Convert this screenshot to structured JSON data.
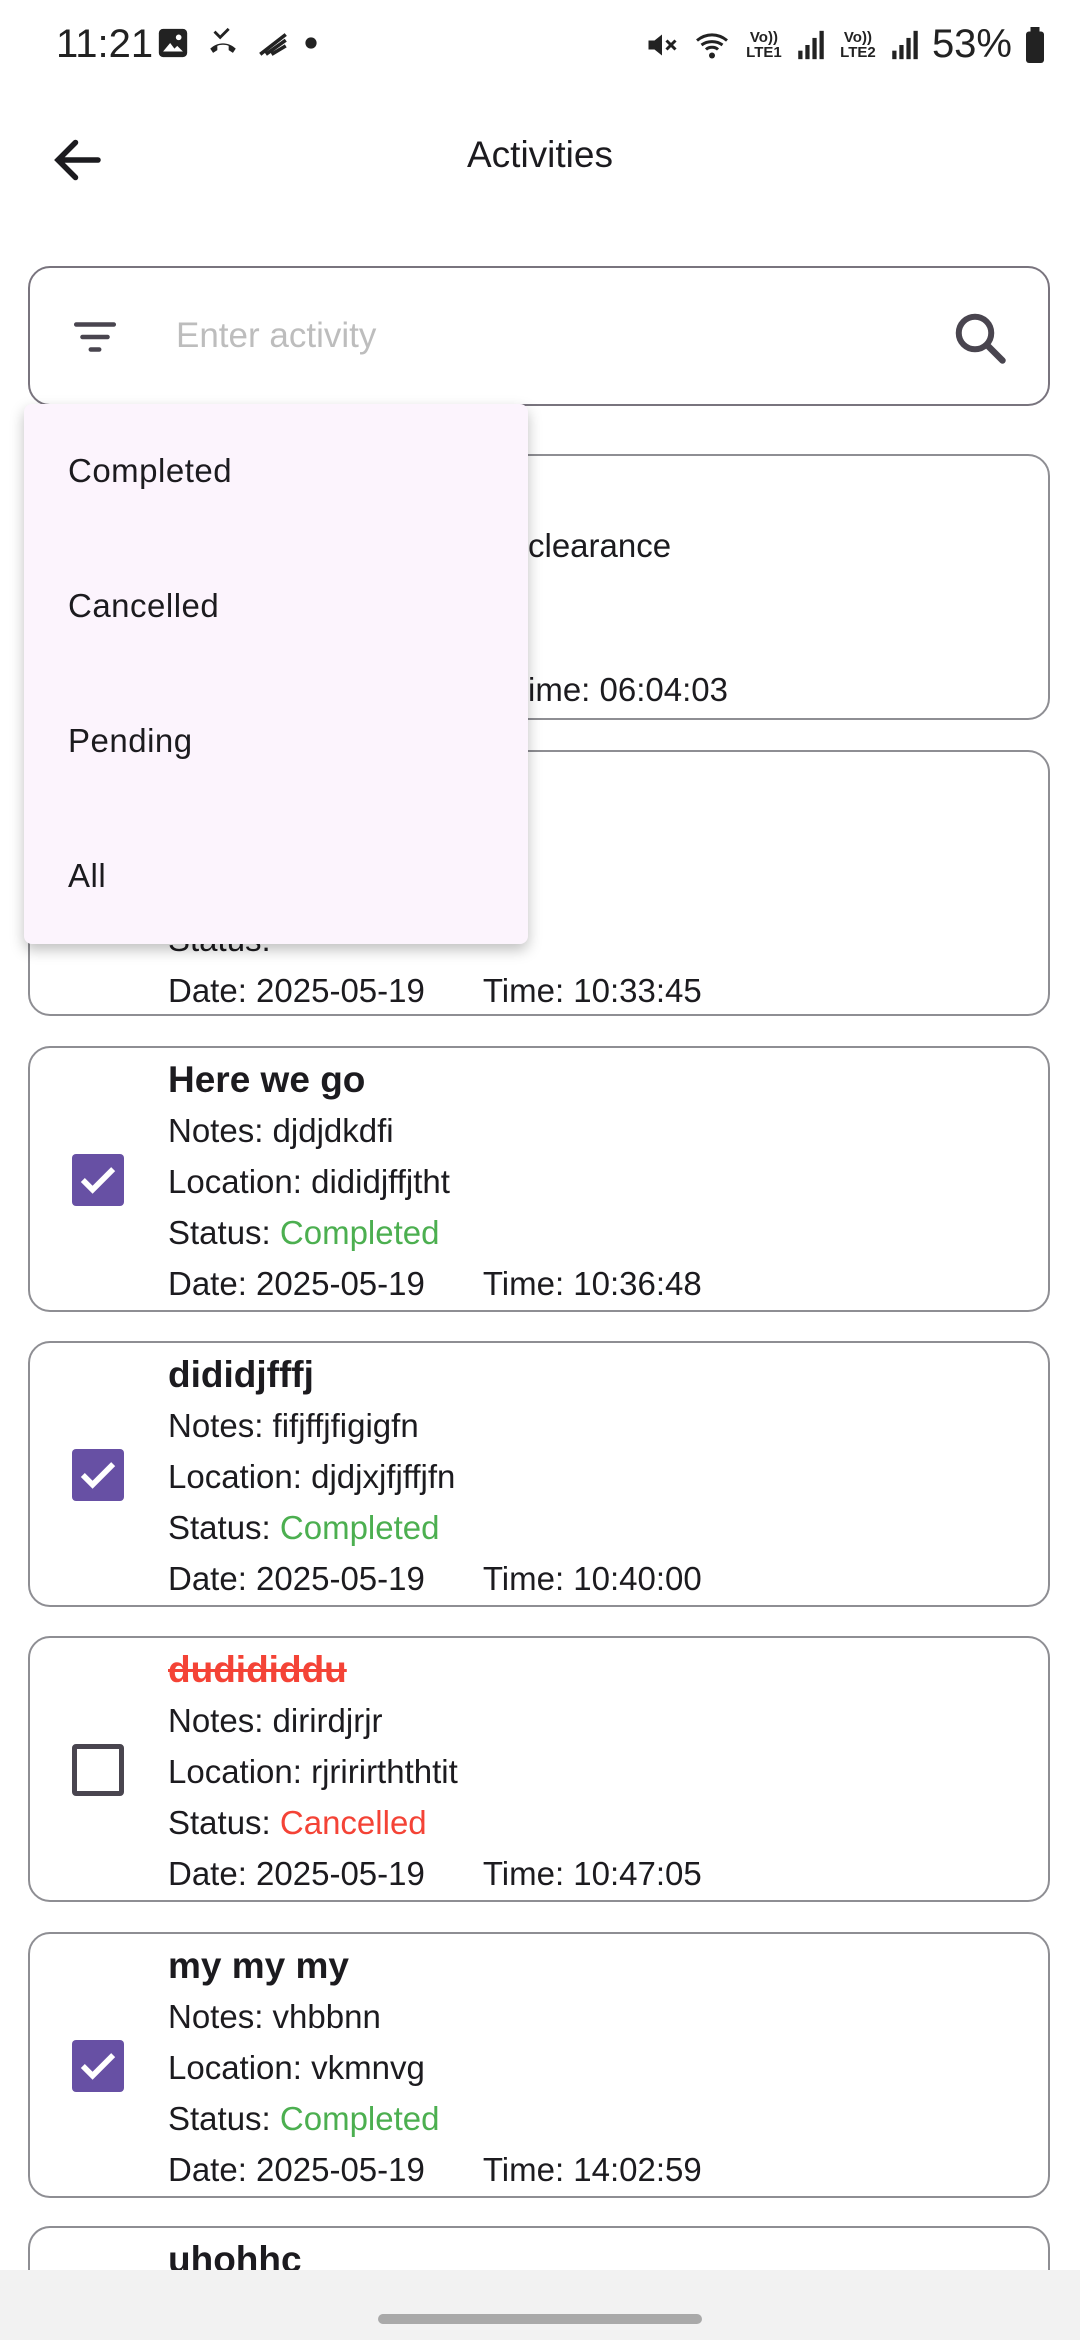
{
  "status_bar": {
    "time": "11:21",
    "battery": "53%",
    "sim1": "Vo)) LTE1",
    "sim2": "Vo)) LTE2"
  },
  "app_bar": {
    "title": "Activities"
  },
  "search": {
    "placeholder": "Enter activity"
  },
  "filter_menu": {
    "items": [
      "Completed",
      "Cancelled",
      "Pending",
      "All"
    ]
  },
  "cards": [
    {
      "title_partial": "clearance",
      "time_line": "ime: 06:04:03"
    },
    {
      "status_label": "Status:",
      "date": "Date: 2025-05-19",
      "time": "Time: 10:33:45"
    },
    {
      "title": "Here we go",
      "notes": "Notes: djdjdkdfi",
      "location": "Location: dididjffjtht",
      "status_label": "Status: ",
      "status": "Completed",
      "date": "Date: 2025-05-19",
      "time": "Time: 10:36:48",
      "checked": true
    },
    {
      "title": "dididjfffj",
      "notes": "Notes: fifjffjfigigfn",
      "location": "Location: djdjxjfjffjfn",
      "status_label": "Status: ",
      "status": "Completed",
      "date": "Date: 2025-05-19",
      "time": "Time: 10:40:00",
      "checked": true
    },
    {
      "title": "dudididdu",
      "notes": "Notes: dirirdjrjr",
      "location": "Location: rjririrththtit",
      "status_label": "Status: ",
      "status": "Cancelled",
      "date": "Date: 2025-05-19",
      "time": "Time: 10:47:05",
      "checked": false
    },
    {
      "title": "my my my",
      "notes": "Notes: vhbbnn",
      "location": "Location: vkmnvg",
      "status_label": "Status: ",
      "status": "Completed",
      "date": "Date: 2025-05-19",
      "time": "Time: 14:02:59",
      "checked": true
    },
    {
      "title": "uhohhc"
    }
  ],
  "colors": {
    "accent": "#6750a4",
    "completed": "#4caf50",
    "cancelled": "#f44336",
    "menu_bg": "#fcf4fd"
  }
}
